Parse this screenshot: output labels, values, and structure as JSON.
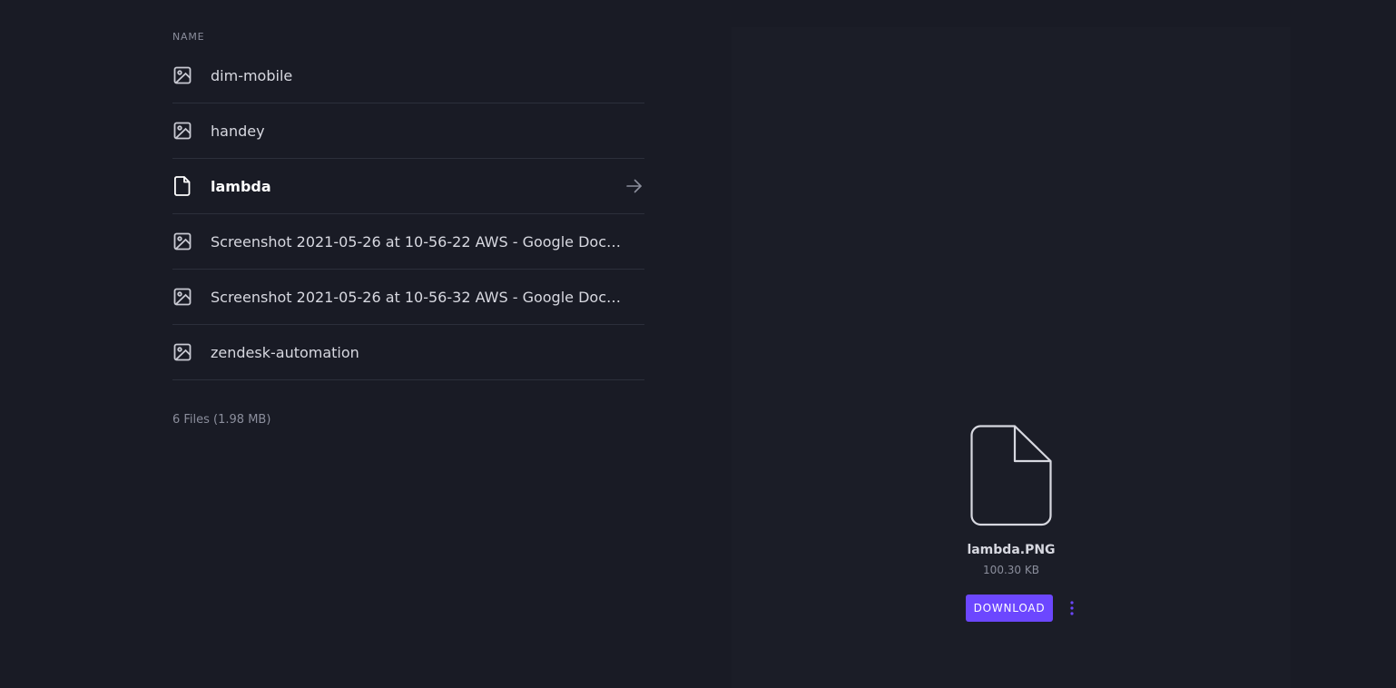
{
  "file_list": {
    "column_header": "NAME",
    "rows": [
      {
        "label": "dim-mobile",
        "icon": "image-icon"
      },
      {
        "label": "handey",
        "icon": "image-icon"
      },
      {
        "label": "lambda",
        "icon": "file-icon",
        "active": true
      },
      {
        "label": "Screenshot 2021-05-26 at 10-56-22 AWS - Google Docs...",
        "icon": "image-icon"
      },
      {
        "label": "Screenshot 2021-05-26 at 10-56-32 AWS - Google Docs...",
        "icon": "image-icon"
      },
      {
        "label": "zendesk-automation",
        "icon": "image-icon"
      }
    ],
    "summary": "6 Files (1.98 MB)"
  },
  "preview": {
    "file_name": "lambda.PNG",
    "file_size": "100.30 KB",
    "download_label": "DOWNLOAD",
    "more_icon": "more-vertical-icon"
  },
  "colors": {
    "background": "#191b25",
    "accent": "#6c47ff",
    "text": "#d7d8e0",
    "muted": "#8b8e9c"
  }
}
